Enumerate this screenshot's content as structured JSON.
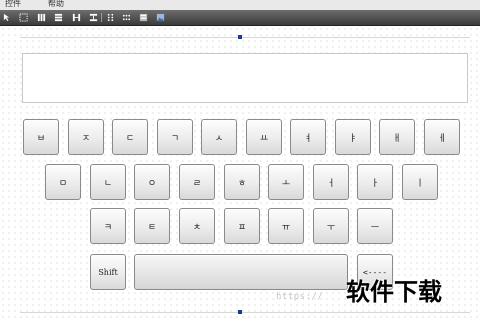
{
  "menu": {
    "items": [
      "控件",
      "帮助"
    ]
  },
  "toolbar": {
    "icons": [
      "pointer-tool-icon",
      "select-tool-icon",
      "align-vertical-icon",
      "align-horizontal-icon",
      "distribute-icon",
      "spacing-icon",
      "grid-dots-icon",
      "grid-dots-alt-icon",
      "list-icon",
      "image-icon"
    ]
  },
  "keyboard": {
    "row1": [
      "ㅂ",
      "ㅈ",
      "ㄷ",
      "ㄱ",
      "ㅅ",
      "ㅛ",
      "ㅕ",
      "ㅑ",
      "ㅐ",
      "ㅔ"
    ],
    "row2": [
      "ㅁ",
      "ㄴ",
      "ㅇ",
      "ㄹ",
      "ㅎ",
      "ㅗ",
      "ㅓ",
      "ㅏ",
      "ㅣ"
    ],
    "row3": [
      "ㅋ",
      "ㅌ",
      "ㅊ",
      "ㅍ",
      "ㅠ",
      "ㅜ",
      "ㅡ"
    ],
    "shift_label": "Shift",
    "space_label": "",
    "backspace_label": "<----"
  },
  "display": {
    "value": ""
  },
  "watermark": {
    "url": "https://",
    "logo": "软件下载"
  },
  "colors": {
    "toolbar": "#4a4a4a",
    "handle": "#1a3c8f",
    "key_border": "#8a8a8a"
  }
}
